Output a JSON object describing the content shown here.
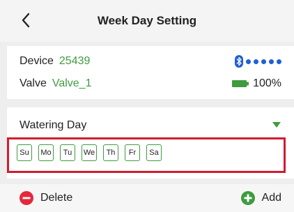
{
  "header": {
    "title": "Week Day Setting",
    "back_icon": "chevron-left-icon"
  },
  "device_info": {
    "device_label": "Device",
    "device_id": "25439",
    "valve_label": "Valve",
    "valve_name": "Valve_1",
    "battery_percent": "100%",
    "signal_icon": "bluetooth-icon",
    "signal_level": 5,
    "battery_icon": "battery-full-icon"
  },
  "watering": {
    "label": "Watering Day",
    "days": [
      "Su",
      "Mo",
      "Tu",
      "We",
      "Th",
      "Fr",
      "Sa"
    ]
  },
  "actions": {
    "delete_label": "Delete",
    "add_label": "Add"
  },
  "colors": {
    "accent_green": "#3f9b3f",
    "delete_red": "#e3283c",
    "bluetooth_blue": "#1f5fd6",
    "highlight_red": "#d11c2e"
  }
}
